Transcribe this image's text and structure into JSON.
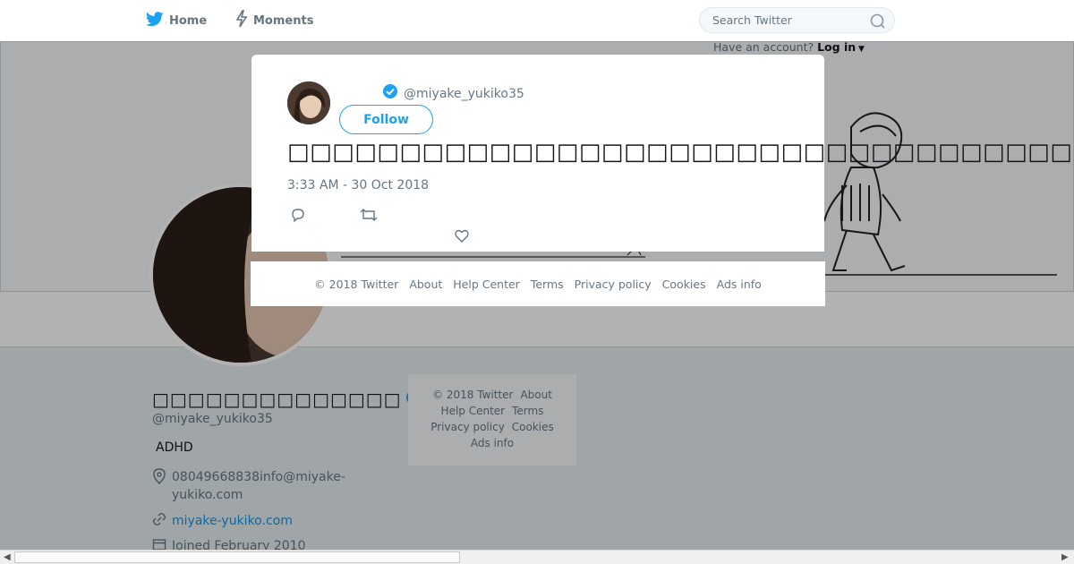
{
  "nav": {
    "home_label": "Home",
    "moments_label": "Moments",
    "search_placeholder": "Search Twitter",
    "have_account": "Have an account?",
    "login_label": "Log in"
  },
  "profile": {
    "display_name": "□□□□□□□□□□□□□□",
    "handle": "@miyake_yukiko35",
    "bio": "ADHD",
    "location": "08049668838info@miyake-yukiko.com",
    "url": "miyake-yukiko.com",
    "joined": "Joined February 2010"
  },
  "side_footer": {
    "copyright": "© 2018 Twitter",
    "about": "About",
    "help": "Help Center",
    "terms": "Terms",
    "privacy": "Privacy policy",
    "cookies": "Cookies",
    "ads": "Ads info"
  },
  "tweet": {
    "handle": "@miyake_yukiko35",
    "follow_label": "Follow",
    "text": "□□□□□□□□□□□□□□□□□□□□□□□□□□□□□□□□□□□□□□□□□□□□□□□□□□□□□□□□□□□□□□□□□□□",
    "timestamp": "3:33 AM - 30 Oct 2018"
  },
  "modal_footer": {
    "copyright": "© 2018 Twitter",
    "about": "About",
    "help": "Help Center",
    "terms": "Terms",
    "privacy": "Privacy policy",
    "cookies": "Cookies",
    "ads": "Ads info"
  },
  "colors": {
    "brand": "#1da1f2",
    "link": "#1b95e0",
    "muted": "#657786"
  },
  "icons": [
    "twitter-bird-icon",
    "lightning-icon",
    "search-icon",
    "close-icon",
    "verified-icon",
    "reply-icon",
    "retweet-icon",
    "heart-icon",
    "location-icon",
    "link-icon",
    "calendar-icon"
  ]
}
